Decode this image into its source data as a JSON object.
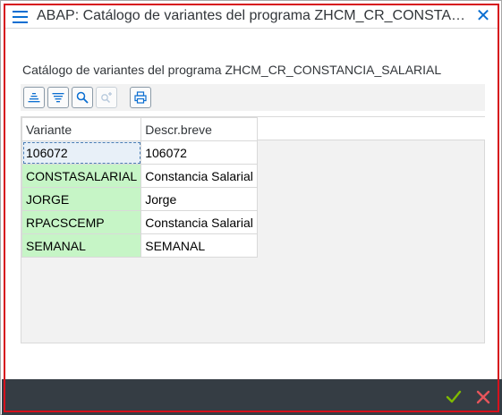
{
  "window": {
    "title": "ABAP: Catálogo de variantes del programa ZHCM_CR_CONSTAN...",
    "close_symbol": "✕"
  },
  "heading": "Catálogo de variantes del programa ZHCM_CR_CONSTANCIA_SALARIAL",
  "toolbar": {
    "buttons": [
      {
        "icon": "sort-ascending-icon",
        "enabled": true
      },
      {
        "icon": "sort-descending-icon",
        "enabled": true
      },
      {
        "icon": "find-icon",
        "enabled": true
      },
      {
        "icon": "find-next-icon",
        "enabled": false
      },
      {
        "icon": "print-icon",
        "enabled": true
      }
    ]
  },
  "table": {
    "columns": [
      "Variante",
      "Descr.breve"
    ],
    "rows": [
      {
        "variante": "106072",
        "descr": "106072"
      },
      {
        "variante": "CONSTASALARIAL",
        "descr": "Constancia Salarial"
      },
      {
        "variante": "JORGE",
        "descr": "Jorge"
      },
      {
        "variante": "RPACSCEMP",
        "descr": "Constancia Salarial"
      },
      {
        "variante": "SEMANAL",
        "descr": "SEMANAL"
      }
    ]
  },
  "footer": {
    "confirm_icon": "checkmark-icon",
    "cancel_icon": "cancel-icon"
  },
  "colors": {
    "accent": "#0a6ed1",
    "focus_border": "#d6111c",
    "key_cell": "#c6f5c6",
    "footer_bg": "#353d44",
    "confirm": "#7fba00",
    "cancel": "#e6555b"
  }
}
